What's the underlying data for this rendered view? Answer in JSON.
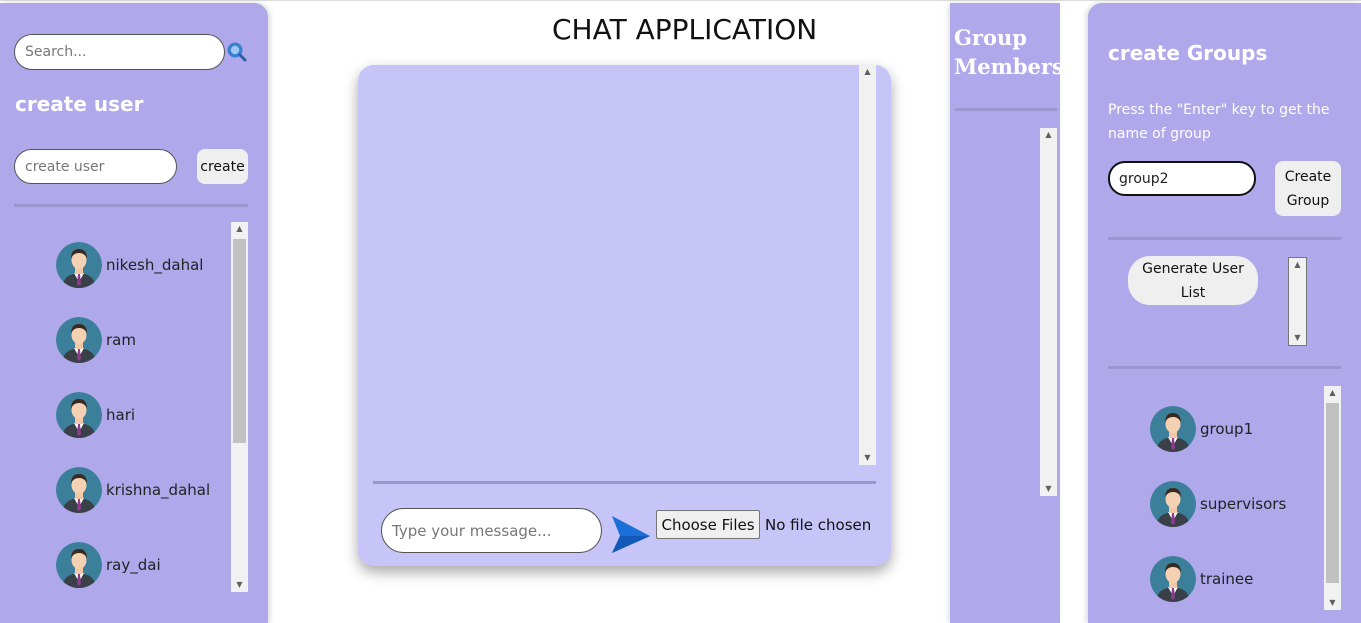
{
  "app": {
    "title": "CHAT APPLICATION"
  },
  "left": {
    "search_placeholder": "Search...",
    "create_user_title": "create user",
    "create_user_placeholder": "create user",
    "create_button": "create",
    "users": [
      {
        "name": "nikesh_dahal"
      },
      {
        "name": "ram"
      },
      {
        "name": "hari"
      },
      {
        "name": "krishna_dahal"
      },
      {
        "name": "ray_dai"
      }
    ]
  },
  "chat": {
    "message_placeholder": "Type your message...",
    "file_button": "Choose Files",
    "file_status": "No file chosen"
  },
  "members": {
    "title": "Group Members"
  },
  "right": {
    "title": "create Groups",
    "hint": "Press the \"Enter\" key to get the name of group",
    "group_name_value": "group2",
    "create_group_button": "Create Group",
    "generate_button": "Generate User List",
    "groups": [
      {
        "name": "group1"
      },
      {
        "name": "supervisors"
      },
      {
        "name": "trainee"
      }
    ]
  },
  "colors": {
    "panel": "#afa8eb",
    "chat_bg": "#c7c5f8",
    "send_icon": "#1a6fd8",
    "divider": "#9b95d0"
  }
}
